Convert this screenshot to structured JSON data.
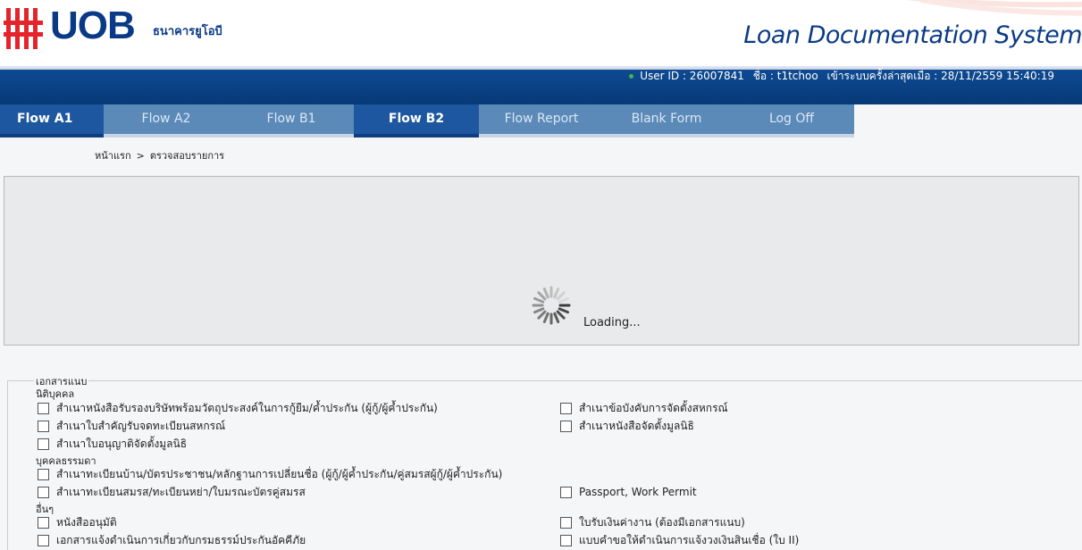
{
  "header": {
    "logo_text": "UOB",
    "logo_subtitle": "ธนาคารยูโอบี",
    "system_title": "Loan Documentation System"
  },
  "userbar": {
    "user_id": "User ID : 26007841",
    "name": "ชื่อ : t1tchoo",
    "last_login": "เข้าระบบครั้งล่าสุดเมื่อ : 28/11/2559 15:40:19"
  },
  "nav": {
    "tabs": [
      {
        "label": "Flow A1",
        "active": true
      },
      {
        "label": "Flow A2",
        "active": false
      },
      {
        "label": "Flow B1",
        "active": false
      },
      {
        "label": "Flow B2",
        "active": true
      },
      {
        "label": "Flow Report",
        "active": false
      },
      {
        "label": "Blank Form",
        "active": false
      },
      {
        "label": "Log Off",
        "active": false
      }
    ]
  },
  "breadcrumb": {
    "home": "หน้าแรก",
    "separator": ">",
    "current": "ตรวจสอบรายการ"
  },
  "loading": {
    "text": "Loading..."
  },
  "attachments": {
    "legend": "เอกสารแนบ",
    "groups": [
      {
        "title": "นิติบุคคล",
        "items": [
          "สำเนาหนังสือรับรองบริษัทพร้อมวัตถุประสงค์ในการกู้ยืม/ค้ำประกัน (ผู้กู้/ผู้ค้ำประกัน)",
          "สำเนาข้อบังคับการจัดตั้งสหกรณ์",
          "สำเนาใบสำคัญรับจดทะเบียนสหกรณ์",
          "สำเนาหนังสือจัดตั้งมูลนิธิ",
          "สำเนาใบอนุญาติจัดตั้งมูลนิธิ"
        ]
      },
      {
        "title": "บุคคลธรรมดา",
        "items": [
          "สำเนาทะเบียนบ้าน/บัตรประชาชน/หลักฐานการเปลี่ยนชื่อ (ผู้กู้/ผู้ค้ำประกัน/คู่สมรสผู้กู้/ผู้ค้ำประกัน)",
          "สำเนาทะเบียนสมรส/ทะเบียนหย่า/ใบมรณะบัตรคู่สมรส",
          "Passport, Work Permit"
        ]
      },
      {
        "title": "อื่นๆ",
        "items": [
          "หนังสืออนุมัติ",
          "ใบรับเงินค่างาน (ต้องมีเอกสารแนบ)",
          "เอกสารแจ้งดำเนินการเกี่ยวกับกรมธรรม์ประกันอัคคีภัย",
          "แบบคำขอให้ดำเนินการแจ้งวงเงินสินเชื่อ (ใบ II)"
        ]
      }
    ]
  }
}
